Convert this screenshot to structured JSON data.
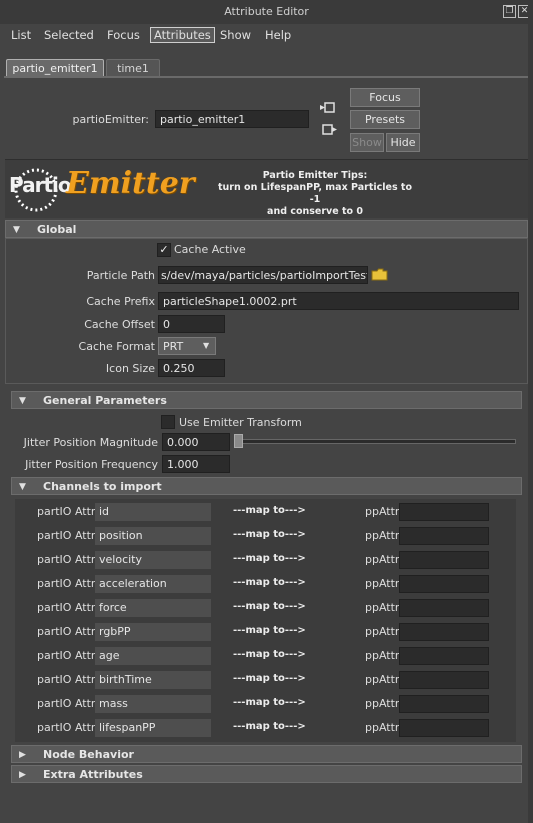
{
  "window": {
    "title": "Attribute Editor"
  },
  "menubar": [
    {
      "label": "List",
      "active": false
    },
    {
      "label": "Selected",
      "active": false
    },
    {
      "label": "Focus",
      "active": false
    },
    {
      "label": "Attributes",
      "active": true
    },
    {
      "label": "Show",
      "active": false
    },
    {
      "label": "Help",
      "active": false
    }
  ],
  "tabs": [
    {
      "label": "partio_emitter1",
      "selected": true
    },
    {
      "label": "time1",
      "selected": false
    }
  ],
  "node": {
    "label": "partioEmitter:",
    "value": "partio_emitter1",
    "buttons": {
      "focus": "Focus",
      "presets": "Presets",
      "show": "Show",
      "hide": "Hide"
    }
  },
  "banner": {
    "logo_partio": "Partio",
    "logo_emitter": "Emitter",
    "tips_title": "Partio Emitter Tips:",
    "tips_line1": "turn on LifespanPP,  max Particles to -1",
    "tips_line2": "and conserve to 0"
  },
  "global": {
    "title": "Global",
    "cache_active_label": "Cache Active",
    "cache_active": true,
    "particle_path_label": "Particle Path",
    "particle_path": "s/dev/maya/particles/partioImportTest/",
    "cache_prefix_label": "Cache Prefix",
    "cache_prefix": "particleShape1.0002.prt",
    "cache_offset_label": "Cache Offset",
    "cache_offset": "0",
    "cache_format_label": "Cache Format",
    "cache_format": "PRT",
    "icon_size_label": "Icon Size",
    "icon_size": "0.250"
  },
  "general": {
    "title": "General Parameters",
    "use_emitter_transform_label": "Use Emitter Transform",
    "use_emitter_transform": false,
    "jitter_mag_label": "Jitter Position Magnitude",
    "jitter_mag": "0.000",
    "jitter_freq_label": "Jitter Position Frequency",
    "jitter_freq": "1.000"
  },
  "channels": {
    "title": "Channels to import",
    "partio_label": "partIO Attr",
    "map_label": "---map to--->",
    "pp_label": "ppAttr",
    "rows": [
      {
        "attr": "id"
      },
      {
        "attr": "position"
      },
      {
        "attr": "velocity"
      },
      {
        "attr": "acceleration"
      },
      {
        "attr": "force"
      },
      {
        "attr": "rgbPP"
      },
      {
        "attr": "age"
      },
      {
        "attr": "birthTime"
      },
      {
        "attr": "mass"
      },
      {
        "attr": "lifespanPP"
      }
    ]
  },
  "node_behavior": {
    "title": "Node Behavior"
  },
  "extra_attributes": {
    "title": "Extra Attributes"
  },
  "colors": {
    "bg": "#444444",
    "field": "#2b2b2b",
    "section": "#5a5a5a",
    "logo_accent": "#f0a020"
  }
}
